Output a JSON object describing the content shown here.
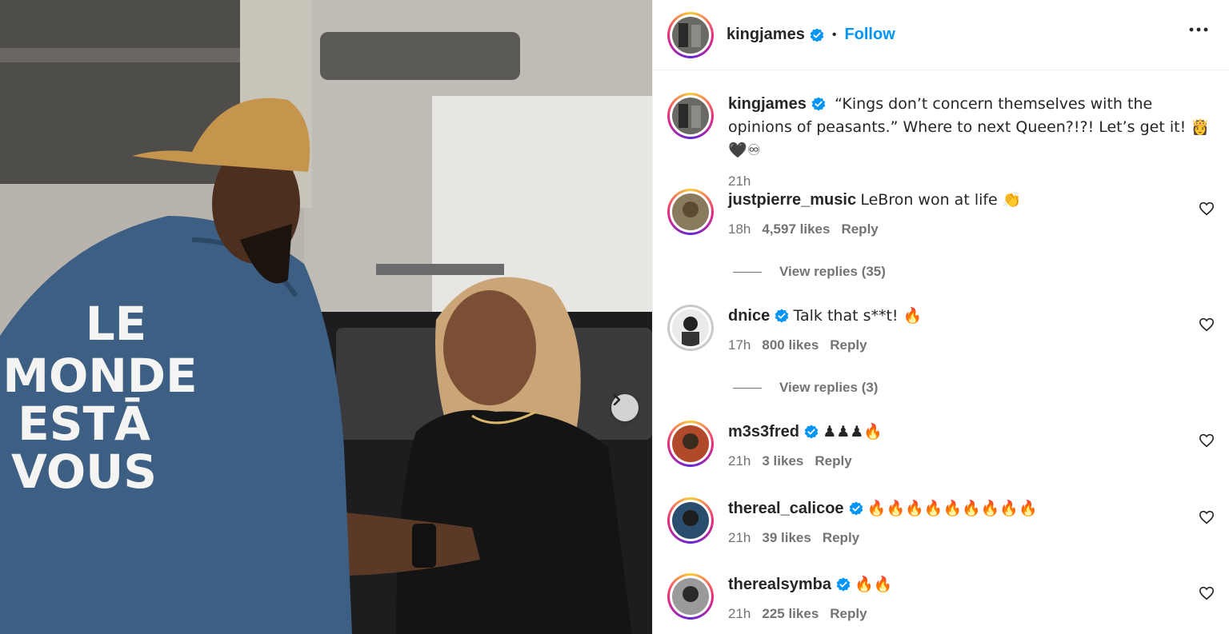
{
  "post": {
    "author": "kingjames",
    "follow_label": "Follow",
    "separator": "•",
    "caption": "“Kings don’t concern themselves with the opinions of peasants.” Where to next Queen?!?! Let’s get it! 👸🖤♾",
    "caption_time": "21h",
    "shirt_text": [
      "LE",
      "MONDE",
      "ESTĀ",
      "VOUS"
    ]
  },
  "comments": [
    {
      "user": "justpierre_music",
      "verified": false,
      "text": "LeBron won at life 👏",
      "time": "18h",
      "likes": "4,597 likes",
      "reply": "Reply",
      "view_replies": "View replies (35)"
    },
    {
      "user": "dnice",
      "verified": true,
      "text": "Talk that s**t! 🔥",
      "time": "17h",
      "likes": "800 likes",
      "reply": "Reply",
      "view_replies": "View replies (3)"
    },
    {
      "user": "m3s3fred",
      "verified": true,
      "text": "♟♟♟🔥",
      "time": "21h",
      "likes": "3 likes",
      "reply": "Reply"
    },
    {
      "user": "thereal_calicoe",
      "verified": true,
      "text": "🔥🔥🔥🔥🔥🔥🔥🔥🔥",
      "time": "21h",
      "likes": "39 likes",
      "reply": "Reply"
    },
    {
      "user": "therealsymba",
      "verified": true,
      "text": "🔥🔥",
      "time": "21h",
      "likes": "225 likes",
      "reply": "Reply"
    }
  ],
  "colors": {
    "accent": "#0095f6",
    "verified": "#0095f6",
    "muted": "#737373"
  },
  "icons": {
    "more": "more-options-icon",
    "heart": "heart-outline-icon",
    "next": "chevron-right-icon",
    "verified": "verified-badge-icon"
  }
}
